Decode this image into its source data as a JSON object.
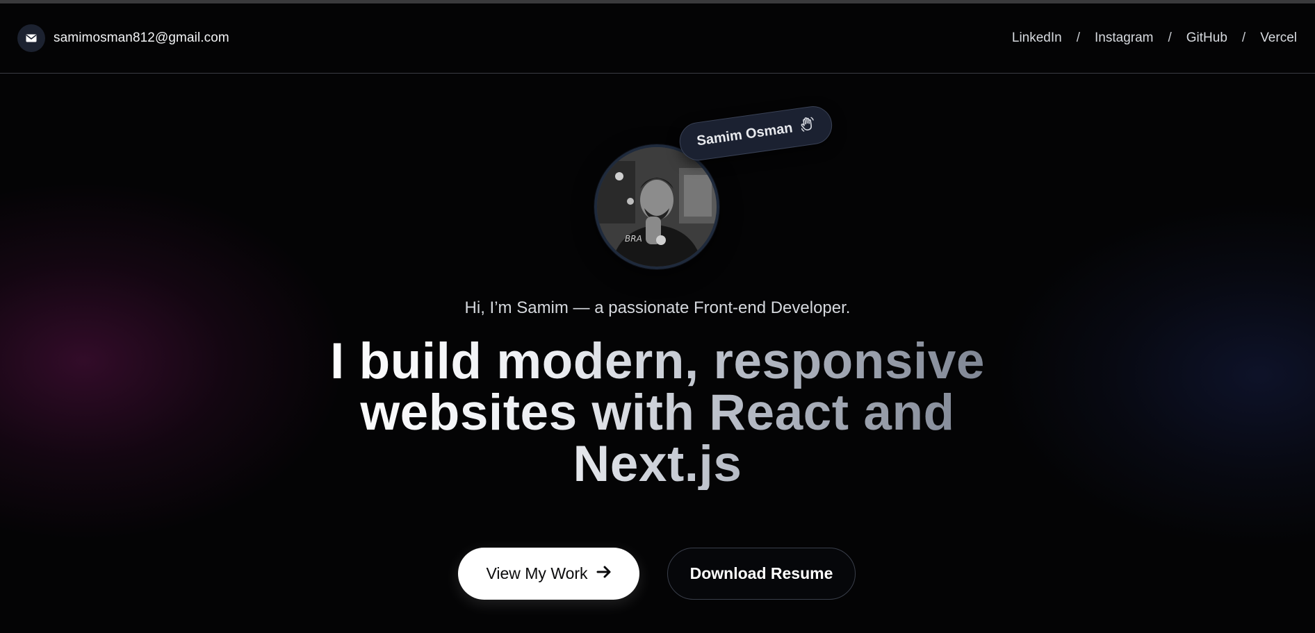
{
  "header": {
    "email": "samimosman812@gmail.com",
    "email_icon": "mail-icon",
    "links": [
      {
        "label": "LinkedIn"
      },
      {
        "label": "Instagram"
      },
      {
        "label": "GitHub"
      },
      {
        "label": "Vercel"
      }
    ],
    "separator": "/"
  },
  "hero": {
    "avatar_alt": "Samim Osman portrait",
    "name_tag": "Samim Osman",
    "name_tag_icon": "waving-hand-icon",
    "subtitle": "Hi, I’m Samim — a passionate Front-end Developer.",
    "headline": "I build modern, responsive websites with React and Next.js"
  },
  "actions": {
    "primary_label": "View My Work",
    "primary_icon": "arrow-right-icon",
    "secondary_label": "Download Resume"
  },
  "colors": {
    "background": "#040405",
    "accent_glow_left": "#58124a",
    "accent_glow_right": "#161e46",
    "tag_bg": "#1b2131"
  }
}
